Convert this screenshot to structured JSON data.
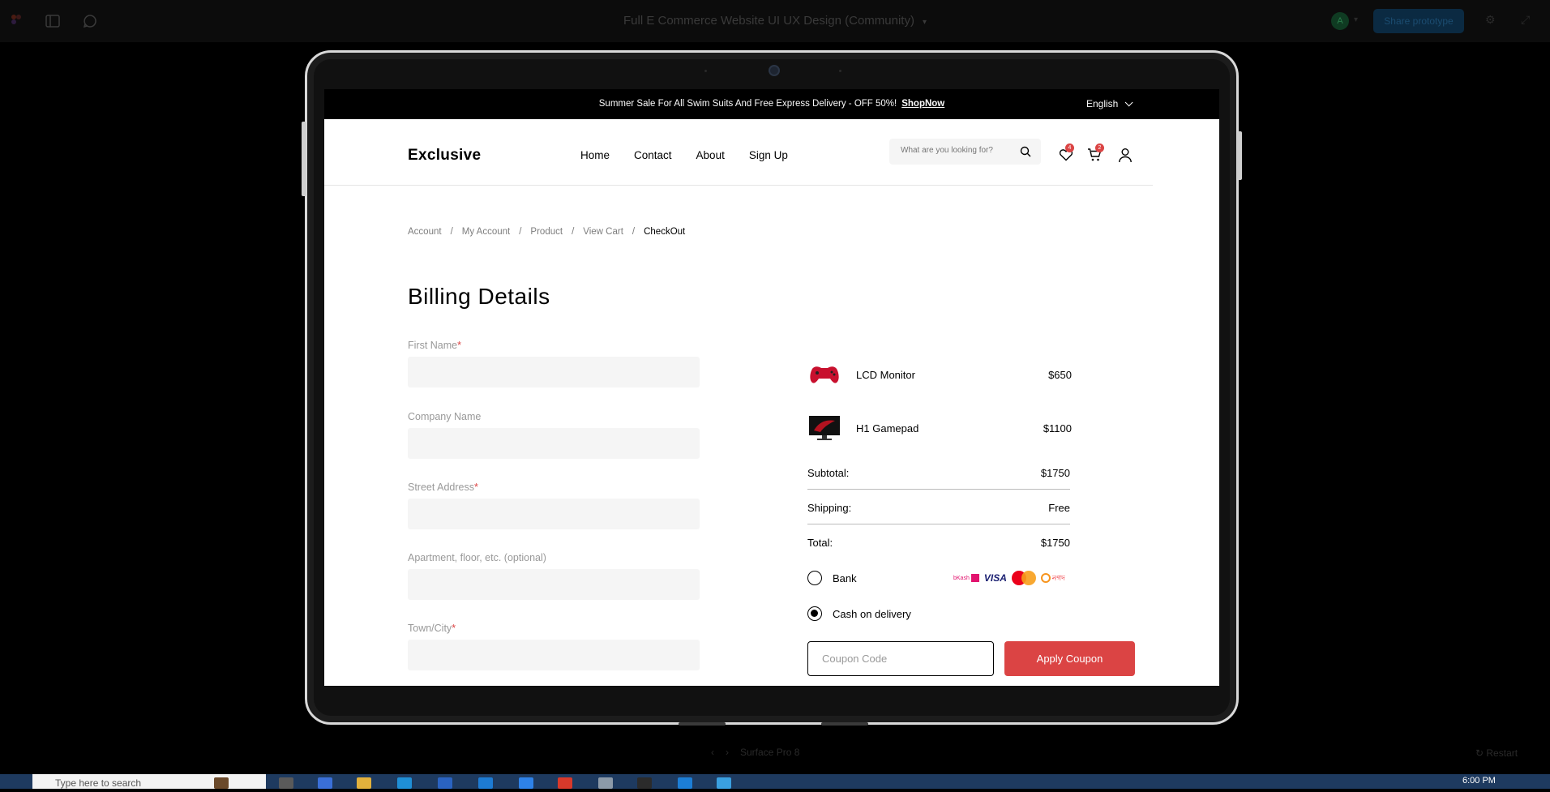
{
  "figma": {
    "file_title": "Full E Commerce Website UI UX Design (Community)",
    "share_label": "Share prototype",
    "avatar_letter": "A",
    "device_name": "Surface Pro 8",
    "restart_label": "Restart"
  },
  "announcement": {
    "text": "Summer Sale For All Swim Suits And Free Express Delivery - OFF 50%!",
    "link": "ShopNow",
    "language": "English"
  },
  "header": {
    "logo": "Exclusive",
    "nav": [
      "Home",
      "Contact",
      "About",
      "Sign Up"
    ],
    "search_placeholder": "What are you looking for?",
    "wishlist_count": "4",
    "cart_count": "2"
  },
  "breadcrumb": [
    "Account",
    "My Account",
    "Product",
    "View Cart",
    "CheckOut"
  ],
  "billing": {
    "title": "Billing Details",
    "fields": [
      {
        "label": "First Name",
        "required": "*"
      },
      {
        "label": "Company Name",
        "required": ""
      },
      {
        "label": "Street Address",
        "required": "*"
      },
      {
        "label": "Apartment, floor, etc. (optional)",
        "required": ""
      },
      {
        "label": "Town/City",
        "required": "*"
      }
    ]
  },
  "order": {
    "items": [
      {
        "name": "LCD Monitor",
        "price": "$650"
      },
      {
        "name": "H1 Gamepad",
        "price": "$1100"
      }
    ],
    "subtotal_label": "Subtotal:",
    "subtotal": "$1750",
    "shipping_label": "Shipping:",
    "shipping": "Free",
    "total_label": "Total:",
    "total": "$1750",
    "payment_options": [
      "Bank",
      "Cash on delivery"
    ],
    "selected_payment": "Cash on delivery",
    "payment_logos": {
      "bkash": "bKash",
      "visa": "VISA",
      "nagad": "নগদ"
    },
    "coupon_placeholder": "Coupon Code",
    "apply_label": "Apply Coupon"
  },
  "taskbar": {
    "search_placeholder": "Type here to search",
    "time": "6:00 PM"
  },
  "colors": {
    "accent": "#DB4444",
    "field_bg": "#F5F5F5"
  }
}
